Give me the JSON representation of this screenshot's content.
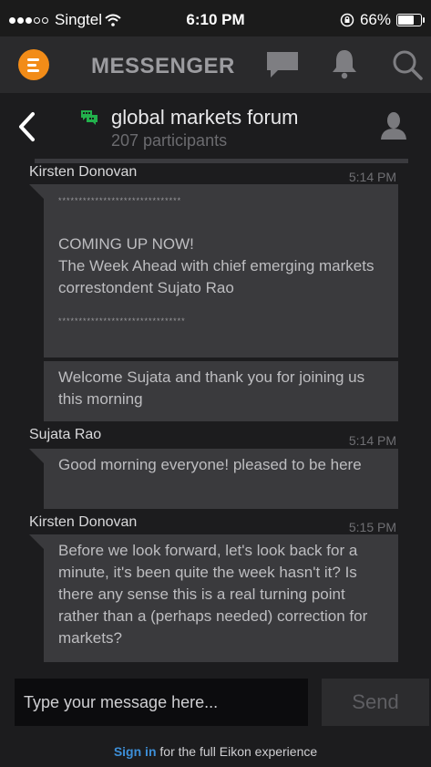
{
  "status_bar": {
    "carrier": "Singtel",
    "time": "6:10 PM",
    "battery": "66%",
    "signal_bars": 3
  },
  "app_header": {
    "title": "MESSENGER"
  },
  "chat_header": {
    "name": "global markets forum",
    "participants": "207 participants"
  },
  "messages": [
    {
      "sender": "Kirsten Donovan",
      "time": "5:14 PM",
      "bubbles": [
        {
          "stars_top": "******************************",
          "lines": [
            "COMING UP NOW!",
            "The Week Ahead with chief emerging markets correstondent Sujato Rao"
          ],
          "stars_bottom": "*******************************"
        },
        {
          "text": "Welcome Sujata and thank you for joining us this morning"
        }
      ]
    },
    {
      "sender": "Sujata Rao",
      "time": "5:14 PM",
      "bubbles": [
        {
          "text": "Good morning everyone! pleased to be here"
        }
      ]
    },
    {
      "sender": "Kirsten Donovan",
      "time": "5:15 PM",
      "bubbles": [
        {
          "text": "Before we look forward, let's look back for a minute, it's been quite the week hasn't it? Is there any sense this is a real turning point rather than a (perhaps needed) correction for markets?"
        }
      ]
    }
  ],
  "composer": {
    "placeholder": "Type your message here...",
    "send_label": "Send"
  },
  "footer": {
    "link": "Sign in",
    "text": " for the full Eikon experience"
  },
  "colors": {
    "accent": "#f28c18",
    "link": "#3d8fd8",
    "forum_icon": "#22b14c"
  },
  "icons": [
    "menu-logo-icon",
    "chat-bubble-icon",
    "bell-icon",
    "search-icon",
    "back-chevron-icon",
    "forum-chat-icon",
    "person-icon"
  ]
}
